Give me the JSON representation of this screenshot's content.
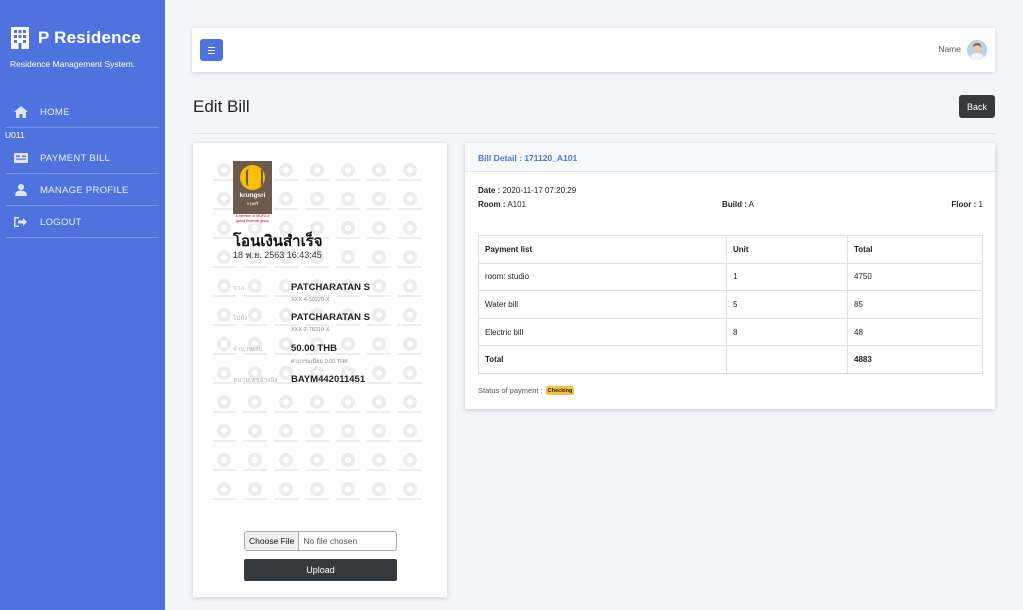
{
  "brand": {
    "title": "P Residence",
    "subtitle": "Residence Management System."
  },
  "sidebar": {
    "user_code": "U011",
    "items": [
      {
        "label": "HOME",
        "icon": "home-icon"
      },
      {
        "label": "PAYMENT BILL",
        "icon": "bill-card-icon"
      },
      {
        "label": "MANAGE PROFILE",
        "icon": "user-icon"
      },
      {
        "label": "LOGOUT",
        "icon": "logout-icon"
      }
    ]
  },
  "topbar": {
    "user_name": "Name",
    "menu_icon": "menu-icon"
  },
  "page": {
    "title": "Edit Bill",
    "back_label": "Back"
  },
  "slip": {
    "bank_name": "krungsri",
    "bank_name_thai": "กรุงศรี",
    "bank_group": "A member of MUFG a global financial group",
    "status": "โอนเงินสำเร็จ",
    "date": "18 พ.ย. 2563 16:43:45",
    "rows": [
      {
        "label": "จาก",
        "value": "PATCHARATAN S",
        "sub": "XXX-4-50220-X"
      },
      {
        "label": "ไปยัง",
        "value": "PATCHARATAN S",
        "sub": "XXX-2-76210-X"
      },
      {
        "label": "จำนวนเงิน",
        "value": "50.00 THB",
        "sub": "ค่าธรรมเนียม 0.00 THB"
      },
      {
        "label": "หมายเลขอ้างอิง",
        "value": "BAYM442011451",
        "sub": ""
      }
    ]
  },
  "upload": {
    "choose_label": "Choose File",
    "file_status": "No file chosen",
    "upload_label": "Upload"
  },
  "bill": {
    "title": "Bill Detail : 171120_A101",
    "date_label": "Date :",
    "date": "2020-11-17 07:20:29",
    "room_label": "Room :",
    "room": "A101",
    "build_label": "Build :",
    "build": "A",
    "floor_label": "Floor :",
    "floor": "1",
    "columns": [
      "Payment list",
      "Unit",
      "Total"
    ],
    "rows": [
      [
        "room: studio",
        "1",
        "4750"
      ],
      [
        "Water bill",
        "5",
        "85"
      ],
      [
        "Electric bill",
        "8",
        "48"
      ]
    ],
    "total_label": "Total",
    "total_value": "4883",
    "status_label": "Status of payment :",
    "status": "Checking"
  },
  "colors": {
    "sidebar": "#4e73df",
    "dark_button": "#343a40",
    "badge": "#f6c23e"
  }
}
